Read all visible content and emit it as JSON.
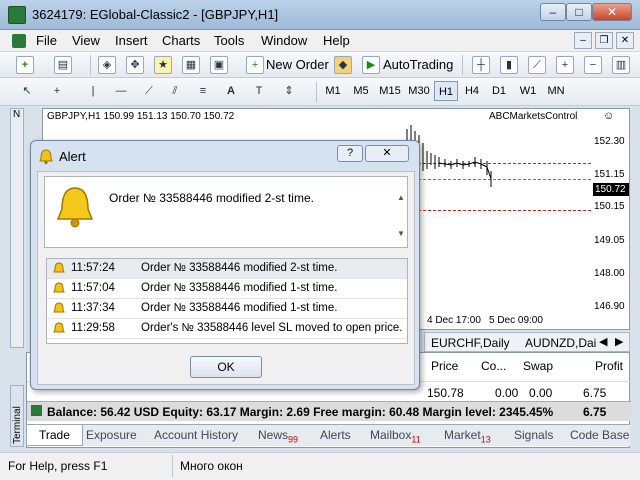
{
  "window": {
    "title": "3624179: EGlobal-Classic2 - [GBPJPY,H1]",
    "min": "–",
    "max": "□",
    "close": "✕"
  },
  "menu": [
    "File",
    "View",
    "Insert",
    "Charts",
    "Tools",
    "Window",
    "Help"
  ],
  "mdi": {
    "min": "–",
    "restore": "❐",
    "close": "✕"
  },
  "toolbar1": {
    "new_order": "New Order",
    "autotrading": "AutoTrading"
  },
  "timeframes": [
    "M1",
    "M5",
    "M15",
    "M30",
    "H1",
    "H4",
    "D1",
    "W1",
    "MN"
  ],
  "chart": {
    "symbol_line": "GBPJPY,H1  150.99 151.13 150.70 150.72",
    "indicator": "ABCMarketsControl",
    "price_labels": [
      "152.30",
      "151.15",
      "150.15",
      "149.05",
      "148.00",
      "146.90"
    ],
    "current_price": "150.72",
    "time_labels": [
      "4 Dec 17:00",
      "5 Dec 09:00"
    ]
  },
  "chart_tabs": [
    "EURCHF,Daily",
    "AUDNZD,Dai"
  ],
  "terminal": {
    "headers": [
      "Price",
      "Co...",
      "Swap",
      "Profit"
    ],
    "row_partial": {
      "price": "150.78",
      "commission": "0.00",
      "swap": "0.00",
      "profit": "6.75"
    },
    "balance_line": "Balance: 56.42 USD  Equity: 63.17  Margin: 2.69  Free margin: 60.48  Margin level: 2345.45%",
    "balance_profit": "6.75",
    "strip_label": "Terminal"
  },
  "bottom_tabs": [
    {
      "label": "Trade",
      "count": ""
    },
    {
      "label": "Exposure",
      "count": ""
    },
    {
      "label": "Account History",
      "count": ""
    },
    {
      "label": "News",
      "count": "99"
    },
    {
      "label": "Alerts",
      "count": ""
    },
    {
      "label": "Mailbox",
      "count": "11"
    },
    {
      "label": "Market",
      "count": "13"
    },
    {
      "label": "Signals",
      "count": ""
    },
    {
      "label": "Code Base",
      "count": ""
    }
  ],
  "status": {
    "help": "For Help, press F1",
    "profile": "Много окон"
  },
  "alert": {
    "title": "Alert",
    "help_btn": "?",
    "close_btn": "✕",
    "message": "Order № 33588446 modified 2-st time.",
    "entries": [
      {
        "time": "11:57:24",
        "text": "Order № 33588446 modified 2-st time."
      },
      {
        "time": "11:57:04",
        "text": "Order № 33588446 modified 1-st time."
      },
      {
        "time": "11:37:34",
        "text": "Order № 33588446 modified 1-st time."
      },
      {
        "time": "11:29:58",
        "text": "Order's № 33588446 level SL moved to open price."
      }
    ],
    "ok": "OK"
  },
  "colors": {
    "accent": "#9fbad8",
    "stop_line": "#d02020",
    "take_line": "#108010"
  }
}
